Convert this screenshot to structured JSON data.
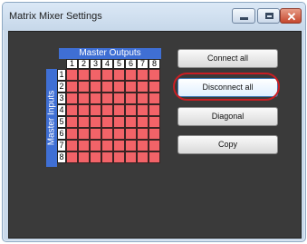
{
  "window": {
    "title": "Matrix Mixer Settings",
    "close_glyph": "✕"
  },
  "matrix": {
    "outputs_label": "Master Outputs",
    "inputs_label": "Master Inputs",
    "output_numbers": [
      "1",
      "2",
      "3",
      "4",
      "5",
      "6",
      "7",
      "8"
    ],
    "input_numbers": [
      "1",
      "2",
      "3",
      "4",
      "5",
      "6",
      "7",
      "8"
    ],
    "cell_color": "#f26368"
  },
  "buttons": {
    "connect_all": "Connect all",
    "disconnect_all": "Disconnect all",
    "diagonal": "Diagonal",
    "copy": "Copy"
  },
  "highlight": {
    "target": "disconnect-all-button",
    "color": "#c81e23"
  }
}
